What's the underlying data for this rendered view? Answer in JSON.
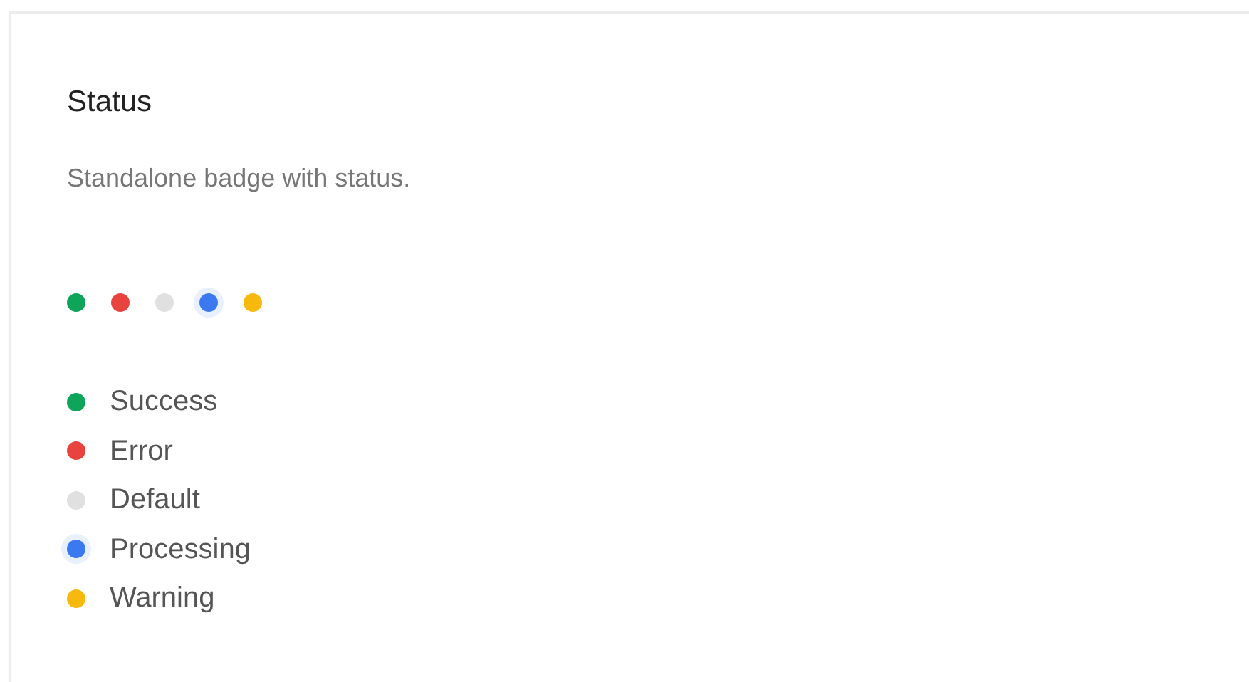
{
  "card": {
    "title": "Status",
    "description": "Standalone badge with status."
  },
  "dots": [
    {
      "color": "#0ea45a",
      "halo": false
    },
    {
      "color": "#e9433f",
      "halo": false
    },
    {
      "color": "#e0e0e0",
      "halo": false
    },
    {
      "color": "#3b79f0",
      "halo": true
    },
    {
      "color": "#f8b90f",
      "halo": false
    }
  ],
  "items": [
    {
      "label": "Success",
      "color": "#0ea45a",
      "halo": false
    },
    {
      "label": "Error",
      "color": "#e9433f",
      "halo": false
    },
    {
      "label": "Default",
      "color": "#e0e0e0",
      "halo": false
    },
    {
      "label": "Processing",
      "color": "#3b79f0",
      "halo": true
    },
    {
      "label": "Warning",
      "color": "#f8b90f",
      "halo": false
    }
  ]
}
